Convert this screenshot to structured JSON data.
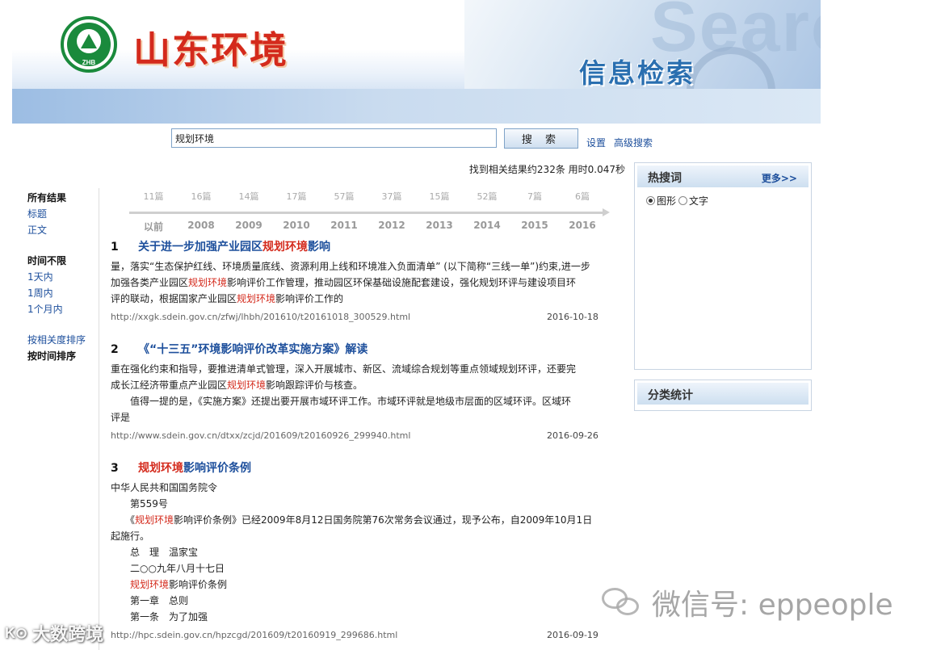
{
  "header": {
    "site_title": "山东环境",
    "sub_title": "信息检索",
    "logo_text": "ZHB",
    "bg_word": "Searc"
  },
  "search": {
    "query": "规划环境",
    "button_label": "搜 索",
    "settings_link": "设置",
    "advanced_link": "高级搜索",
    "stats": "找到相关结果约232条 用时0.047秒"
  },
  "filters": {
    "scope": {
      "heading": "所有结果",
      "items": [
        "标题",
        "正文"
      ]
    },
    "time": {
      "heading": "时间不限",
      "items": [
        "1天内",
        "1周内",
        "1个月内"
      ]
    },
    "sort": {
      "relevance": "按相关度排序",
      "time": "按时间排序"
    }
  },
  "timeline": {
    "counts": [
      "11篇",
      "16篇",
      "14篇",
      "17篇",
      "57篇",
      "37篇",
      "15篇",
      "52篇",
      "7篇",
      "6篇"
    ],
    "years": [
      "以前",
      "2008",
      "2009",
      "2010",
      "2011",
      "2012",
      "2013",
      "2014",
      "2015",
      "2016"
    ]
  },
  "results": [
    {
      "num": "1",
      "title_pre": "关于进一步加强产业园区",
      "title_hl": "规划环境",
      "title_post": "影响",
      "body": [
        [
          "量，落实“生态保护红线、环境质量底线、资源利用上线和环境准入负面清单” (以下简称“三线一单”)约束,进一步",
          "",
          ""
        ],
        [
          "加强各类产业园区",
          "规划环境",
          "影响评价工作管理，推动园区环保基础设施配套建设，强化规划环评与建设项目环"
        ],
        [
          "评的联动，根据国家产业园区",
          "规划环境",
          "影响评价工作的"
        ]
      ],
      "url": "http://xxgk.sdein.gov.cn/zfwj/lhbh/201610/t20161018_300529.html",
      "date": "2016-10-18"
    },
    {
      "num": "2",
      "title_pre": "《“十三五”环境影响评价改革实施方案》解读",
      "title_hl": "",
      "title_post": "",
      "body": [
        [
          "重在强化约束和指导，要推进清单式管理，深入开展城市、新区、流域综合规划等重点领域规划环评，还要完",
          "",
          ""
        ],
        [
          "成长江经济带重点产业园区",
          "规划环境",
          "影响跟踪评价与核查。"
        ],
        [
          "　　值得一提的是，《实施方案》还提出要开展市域环评工作。市域环评就是地级市层面的区域环评。区域环",
          "",
          ""
        ],
        [
          "评是",
          "",
          ""
        ]
      ],
      "url": "http://www.sdein.gov.cn/dtxx/zcjd/201609/t20160926_299940.html",
      "date": "2016-09-26"
    },
    {
      "num": "3",
      "title_pre": "",
      "title_hl": "规划环境",
      "title_post": "影响评价条例",
      "body": [
        [
          " 中华人民共和国国务院令",
          "",
          ""
        ],
        [
          "　　第559号",
          "",
          ""
        ],
        [
          "　　《",
          "规划环境",
          "影响评价条例》已经2009年8月12日国务院第76次常务会议通过，现予公布，自2009年10月1日"
        ],
        [
          "起施行。",
          "",
          ""
        ],
        [
          "　　总　理　温家宝",
          "",
          ""
        ],
        [
          "　　二○○九年八月十七日",
          "",
          ""
        ],
        [
          "　　",
          "规划环境",
          "影响评价条例"
        ],
        [
          "　　第一章　总则",
          "",
          ""
        ],
        [
          "　　第一条　为了加强",
          "",
          ""
        ]
      ],
      "url": "http://hpc.sdein.gov.cn/hpzcgd/201609/t20160919_299686.html",
      "date": "2016-09-19"
    }
  ],
  "sidebar": {
    "hot": {
      "title": "热搜词",
      "more": "更多>>",
      "options": [
        "图形",
        "文字"
      ],
      "selected": "图形"
    },
    "category": {
      "title": "分类统计"
    }
  },
  "watermarks": {
    "wechat": "微信号: eppeople",
    "bottom_logo": "K⊙",
    "bottom_text": "大数跨境"
  }
}
